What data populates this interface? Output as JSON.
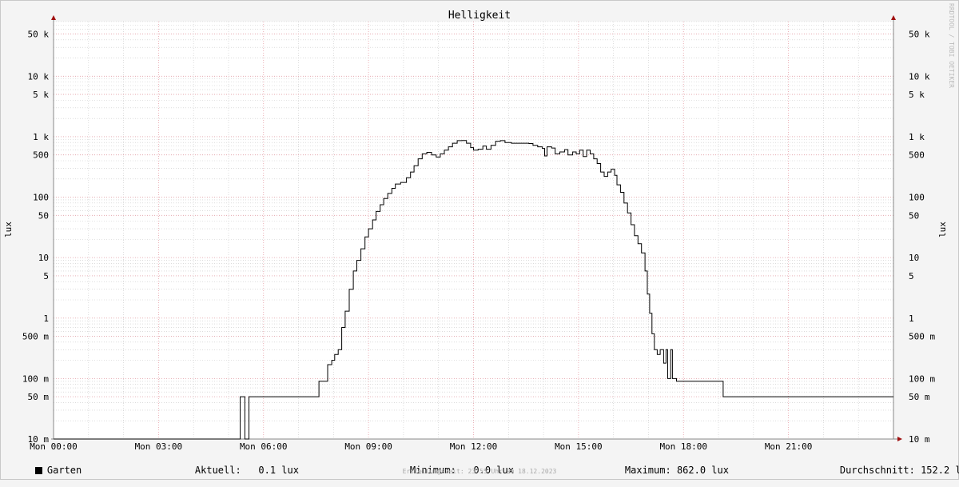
{
  "chart_data": {
    "type": "line",
    "title": "Helligkeit",
    "ylabel": "lux",
    "yscale": "log",
    "ylim": [
      0.01,
      80000
    ],
    "xlim": [
      "00:00",
      "24:00"
    ],
    "x_ticks": [
      "Mon 00:00",
      "Mon 03:00",
      "Mon 06:00",
      "Mon 09:00",
      "Mon 12:00",
      "Mon 15:00",
      "Mon 18:00",
      "Mon 21:00"
    ],
    "y_ticks": [
      {
        "value": 0.01,
        "label": "10 m"
      },
      {
        "value": 0.05,
        "label": "50 m"
      },
      {
        "value": 0.1,
        "label": "100 m"
      },
      {
        "value": 0.5,
        "label": "500 m"
      },
      {
        "value": 1,
        "label": "1"
      },
      {
        "value": 5,
        "label": "5"
      },
      {
        "value": 10,
        "label": "10"
      },
      {
        "value": 50,
        "label": "50"
      },
      {
        "value": 100,
        "label": "100"
      },
      {
        "value": 500,
        "label": "500"
      },
      {
        "value": 1000,
        "label": "1 k"
      },
      {
        "value": 5000,
        "label": "5 k"
      },
      {
        "value": 10000,
        "label": "10 k"
      },
      {
        "value": 50000,
        "label": "50 k"
      }
    ],
    "grid": true,
    "series": [
      {
        "name": "Garten",
        "color": "#000000",
        "step": true,
        "points": [
          [
            "00:00",
            0.01
          ],
          [
            "05:20",
            0.01
          ],
          [
            "05:20",
            0.05
          ],
          [
            "05:28",
            0.05
          ],
          [
            "05:28",
            0.01
          ],
          [
            "05:35",
            0.01
          ],
          [
            "05:35",
            0.05
          ],
          [
            "07:35",
            0.05
          ],
          [
            "07:35",
            0.09
          ],
          [
            "07:50",
            0.09
          ],
          [
            "07:50",
            0.17
          ],
          [
            "07:57",
            0.2
          ],
          [
            "08:02",
            0.25
          ],
          [
            "08:08",
            0.3
          ],
          [
            "08:14",
            0.7
          ],
          [
            "08:20",
            1.3
          ],
          [
            "08:27",
            3
          ],
          [
            "08:34",
            6
          ],
          [
            "08:40",
            9
          ],
          [
            "08:47",
            14
          ],
          [
            "08:54",
            22
          ],
          [
            "09:00",
            30
          ],
          [
            "09:07",
            42
          ],
          [
            "09:13",
            58
          ],
          [
            "09:20",
            75
          ],
          [
            "09:26",
            95
          ],
          [
            "09:33",
            115
          ],
          [
            "09:40",
            140
          ],
          [
            "09:46",
            165
          ],
          [
            "09:55",
            175
          ],
          [
            "10:05",
            210
          ],
          [
            "10:12",
            260
          ],
          [
            "10:18",
            330
          ],
          [
            "10:25",
            430
          ],
          [
            "10:32",
            520
          ],
          [
            "10:40",
            550
          ],
          [
            "10:48",
            500
          ],
          [
            "10:56",
            460
          ],
          [
            "11:03",
            520
          ],
          [
            "11:10",
            600
          ],
          [
            "11:17",
            680
          ],
          [
            "11:24",
            780
          ],
          [
            "11:32",
            860
          ],
          [
            "11:40",
            862
          ],
          [
            "11:48",
            780
          ],
          [
            "11:55",
            660
          ],
          [
            "12:00",
            600
          ],
          [
            "12:08",
            620
          ],
          [
            "12:16",
            700
          ],
          [
            "12:22",
            620
          ],
          [
            "12:30",
            720
          ],
          [
            "12:38",
            840
          ],
          [
            "12:46",
            860
          ],
          [
            "12:54",
            800
          ],
          [
            "13:05",
            780
          ],
          [
            "13:20",
            780
          ],
          [
            "13:35",
            770
          ],
          [
            "13:42",
            720
          ],
          [
            "13:50",
            680
          ],
          [
            "13:58",
            640
          ],
          [
            "14:02",
            480
          ],
          [
            "14:06",
            680
          ],
          [
            "14:14",
            650
          ],
          [
            "14:20",
            520
          ],
          [
            "14:28",
            560
          ],
          [
            "14:36",
            610
          ],
          [
            "14:42",
            500
          ],
          [
            "14:50",
            560
          ],
          [
            "14:56",
            520
          ],
          [
            "15:02",
            600
          ],
          [
            "15:08",
            470
          ],
          [
            "15:14",
            600
          ],
          [
            "15:20",
            520
          ],
          [
            "15:26",
            430
          ],
          [
            "15:32",
            360
          ],
          [
            "15:38",
            260
          ],
          [
            "15:44",
            220
          ],
          [
            "15:50",
            260
          ],
          [
            "15:56",
            290
          ],
          [
            "16:02",
            230
          ],
          [
            "16:06",
            160
          ],
          [
            "16:12",
            120
          ],
          [
            "16:18",
            80
          ],
          [
            "16:24",
            55
          ],
          [
            "16:30",
            35
          ],
          [
            "16:36",
            23
          ],
          [
            "16:42",
            17
          ],
          [
            "16:48",
            12
          ],
          [
            "16:54",
            6
          ],
          [
            "16:58",
            2.5
          ],
          [
            "17:02",
            1.2
          ],
          [
            "17:06",
            0.55
          ],
          [
            "17:10",
            0.3
          ],
          [
            "17:15",
            0.25
          ],
          [
            "17:20",
            0.3
          ],
          [
            "17:26",
            0.18
          ],
          [
            "17:30",
            0.3
          ],
          [
            "17:33",
            0.1
          ],
          [
            "17:38",
            0.3
          ],
          [
            "17:41",
            0.1
          ],
          [
            "17:48",
            0.09
          ],
          [
            "19:08",
            0.09
          ],
          [
            "19:08",
            0.05
          ],
          [
            "24:00",
            0.05
          ]
        ]
      }
    ]
  },
  "legend": {
    "label": "Garten",
    "current_label": "Aktuell:",
    "current_value": "0.1 lux",
    "minimum_label": "Minimum:",
    "minimum_value": "0.0 lux",
    "maximum_label": "Maximum:",
    "maximum_value": "862.0 lux",
    "average_label": "Durchschnitt:",
    "average_value": "152.2 lux"
  },
  "footer": "Erstellungszeit: 23:55 Uhr am 18.12.2023",
  "credit": "RRDTOOL / TOBI OETIKER",
  "colors": {
    "major_grid": "#e6a0a8",
    "minor_grid": "#c8c8c8",
    "axis": "#888888",
    "arrow": "#a01010",
    "plot_bg": "#ffffff"
  }
}
